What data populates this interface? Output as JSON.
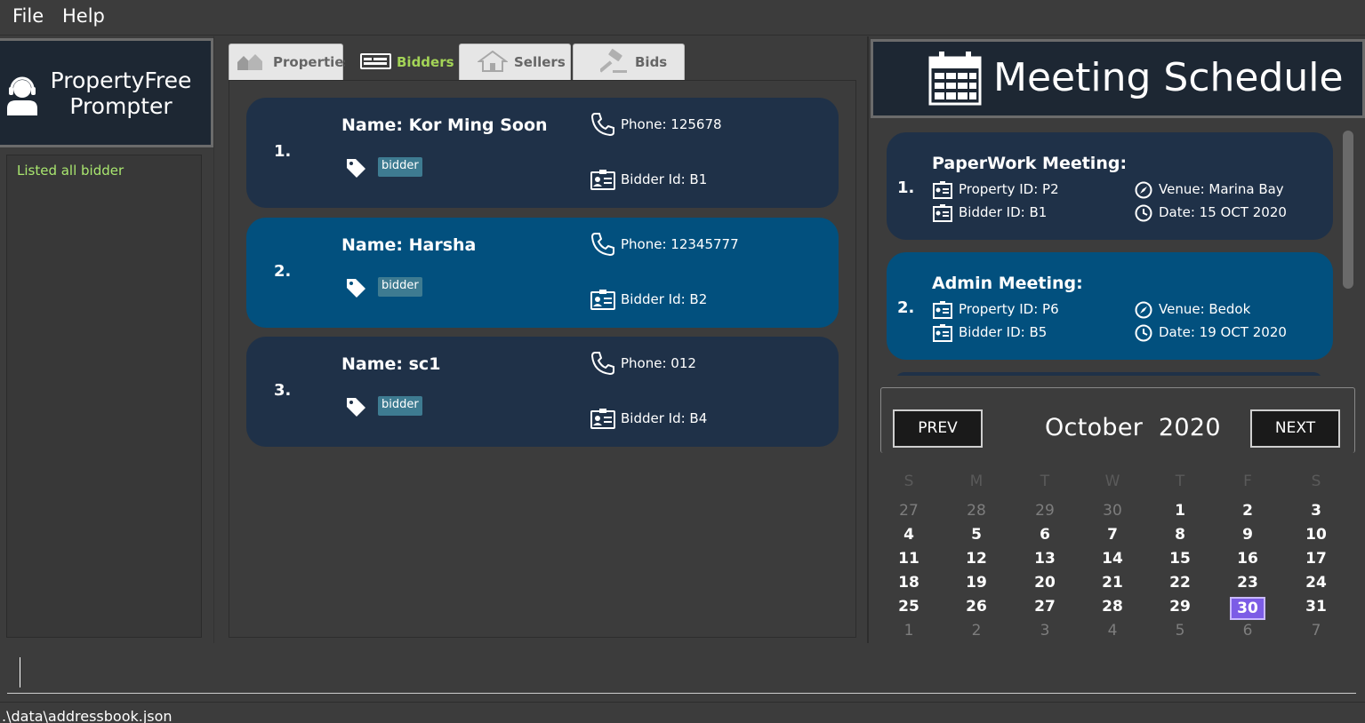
{
  "menu": {
    "file": "File",
    "help": "Help"
  },
  "brand": {
    "line1": "PropertyFree",
    "line2": "Prompter"
  },
  "result": {
    "message": "Listed all bidder"
  },
  "tabs": [
    {
      "label": "Properties",
      "icon": "houses-icon"
    },
    {
      "label": "Bidders",
      "icon": "card-icon"
    },
    {
      "label": "Sellers",
      "icon": "house-icon"
    },
    {
      "label": "Bids",
      "icon": "gavel-icon"
    }
  ],
  "active_tab": "Bidders",
  "bidders": [
    {
      "index": "1.",
      "name": "Name: Kor Ming Soon",
      "tag": "bidder",
      "phone": "Phone: 125678",
      "bidder_id": "Bidder Id: B1"
    },
    {
      "index": "2.",
      "name": "Name: Harsha",
      "tag": "bidder",
      "phone": "Phone: 12345777",
      "bidder_id": "Bidder Id: B2"
    },
    {
      "index": "3.",
      "name": "Name: sc1",
      "tag": "bidder",
      "phone": "Phone: 012",
      "bidder_id": "Bidder Id: B4"
    }
  ],
  "selected_bidder": 2,
  "schedule": {
    "title": "Meeting Schedule",
    "meetings": [
      {
        "index": "1.",
        "title": "PaperWork Meeting:",
        "property_id": "Property ID: P2",
        "bidder_id": "Bidder ID: B1",
        "venue": "Venue: Marina Bay",
        "date": "Date: 15 OCT 2020"
      },
      {
        "index": "2.",
        "title": "Admin Meeting:",
        "property_id": "Property ID: P6",
        "bidder_id": "Bidder ID: B5",
        "venue": "Venue: Bedok",
        "date": "Date: 19 OCT 2020"
      }
    ]
  },
  "calendar": {
    "prev": "PREV",
    "next": "NEXT",
    "month": "October",
    "year": "2020",
    "weekdays": [
      "S",
      "M",
      "T",
      "W",
      "T",
      "F",
      "S"
    ],
    "weeks": [
      [
        "27",
        "28",
        "29",
        "30",
        "1",
        "2",
        "3"
      ],
      [
        "4",
        "5",
        "6",
        "7",
        "8",
        "9",
        "10"
      ],
      [
        "11",
        "12",
        "13",
        "14",
        "15",
        "16",
        "17"
      ],
      [
        "18",
        "19",
        "20",
        "21",
        "22",
        "23",
        "24"
      ],
      [
        "25",
        "26",
        "27",
        "28",
        "29",
        "30",
        "31"
      ],
      [
        "1",
        "2",
        "3",
        "4",
        "5",
        "6",
        "7"
      ]
    ],
    "today": "30",
    "colors": {
      "today_bg": "#7c5ce6"
    }
  },
  "command": {
    "value": ""
  },
  "status": {
    "path": ".\\data\\addressbook.json"
  }
}
